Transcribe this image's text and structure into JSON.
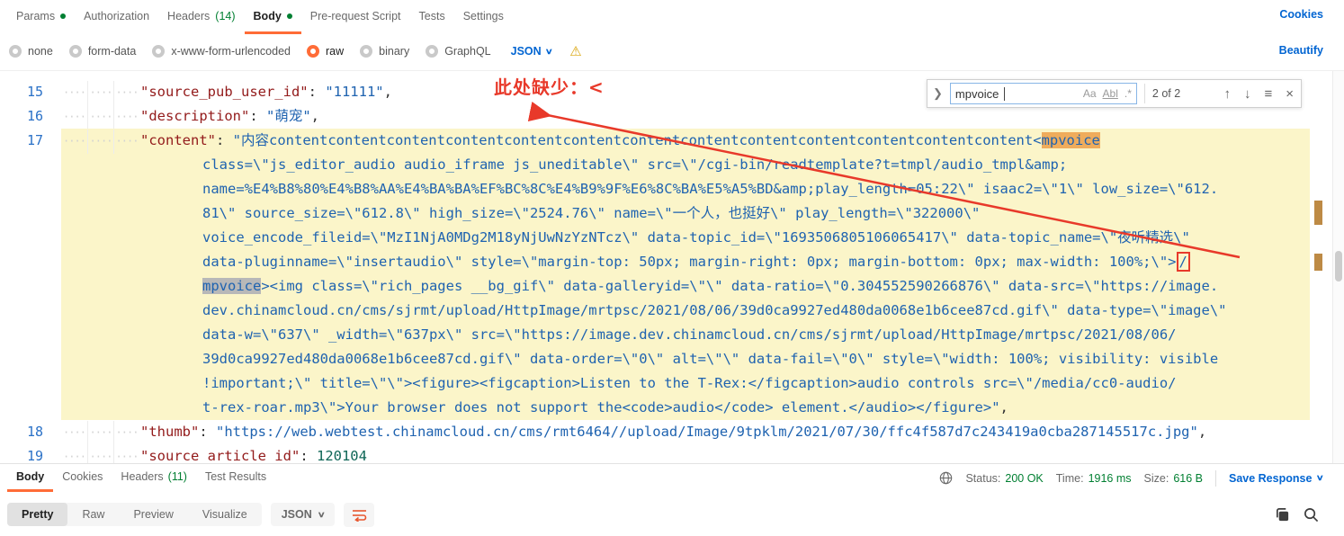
{
  "request_tabs": {
    "items": [
      {
        "label": "Params",
        "dot": true,
        "active": false
      },
      {
        "label": "Authorization",
        "active": false
      },
      {
        "label": "Headers",
        "count": "(14)",
        "active": false
      },
      {
        "label": "Body",
        "dot": true,
        "active": true
      },
      {
        "label": "Pre-request Script",
        "active": false
      },
      {
        "label": "Tests",
        "active": false
      },
      {
        "label": "Settings",
        "active": false
      }
    ],
    "cookies_link": "Cookies"
  },
  "body_type_bar": {
    "options": [
      {
        "label": "none",
        "selected": false
      },
      {
        "label": "form-data",
        "selected": false
      },
      {
        "label": "x-www-form-urlencoded",
        "selected": false
      },
      {
        "label": "raw",
        "selected": true
      },
      {
        "label": "binary",
        "selected": false
      },
      {
        "label": "GraphQL",
        "selected": false
      }
    ],
    "language": "JSON",
    "warning_icon": "warning-triangle",
    "beautify_link": "Beautify"
  },
  "search_panel": {
    "query": "mpvoice",
    "match_case": "Aa",
    "whole_word": "Abl",
    "regex": ".*",
    "result_count": "2 of 2",
    "buttons": [
      "previous-match",
      "next-match",
      "menu",
      "close"
    ]
  },
  "annotation": {
    "text": "此处缺少：<",
    "color": "#e8392a"
  },
  "editor": {
    "lines": [
      {
        "number": "15",
        "highlighted": false,
        "rows": [
          {
            "segments": [
              {
                "t": "\"source_pub_user_id\"",
                "c": "key"
              },
              {
                "t": ": ",
                "c": "p"
              },
              {
                "t": "\"11111\"",
                "c": "str"
              },
              {
                "t": ",",
                "c": "p"
              }
            ]
          }
        ]
      },
      {
        "number": "16",
        "highlighted": false,
        "rows": [
          {
            "segments": [
              {
                "t": "\"description\"",
                "c": "key"
              },
              {
                "t": ": ",
                "c": "p"
              },
              {
                "t": "\"萌宠\"",
                "c": "str"
              },
              {
                "t": ",",
                "c": "p"
              }
            ]
          }
        ]
      },
      {
        "number": "17",
        "highlighted": true,
        "rows": [
          {
            "segments": [
              {
                "t": "\"content\"",
                "c": "key"
              },
              {
                "t": ": ",
                "c": "p"
              },
              {
                "t": "\"内容contentcontentcontentcontentcontentcontentcontentcontentcontentcontentcontentcontentcontent<",
                "c": "str"
              },
              {
                "t": "mpvoice",
                "c": "mc"
              }
            ]
          },
          {
            "segments": [
              {
                "t": "class=\\\"js_editor_audio audio_iframe js_uneditable\\\" src=\\\"/cgi-bin/readtemplate?t=tmpl/audio_tmpl&amp;",
                "c": "str"
              }
            ]
          },
          {
            "segments": [
              {
                "t": "name=%E4%B8%80%E4%B8%AA%E4%BA%BA%EF%BC%8C%E4%B9%9F%E6%8C%BA%E5%A5%BD&amp;play_length=05:22\\\" isaac2=\\\"1\\\" low_size=\\\"612.",
                "c": "str"
              }
            ]
          },
          {
            "segments": [
              {
                "t": "81\\\" source_size=\\\"612.8\\\" high_size=\\\"2524.76\\\" name=\\\"一个人，也挺好\\\" play_length=\\\"322000\\\"",
                "c": "str"
              }
            ]
          },
          {
            "segments": [
              {
                "t": "voice_encode_fileid=\\\"MzI1NjA0MDg2M18yNjUwNzYzNTcz\\\" data-topic_id=\\\"1693506805106065417\\\" data-topic_name=\\\"夜听精选\\\"",
                "c": "str"
              }
            ]
          },
          {
            "segments": [
              {
                "t": "data-pluginname=\\\"insertaudio\\\" style=\\\"margin-top: 50px; margin-right: 0px; margin-bottom: 0px; max-width: 100%;\\\">",
                "c": "str"
              },
              {
                "t": "/",
                "c": "rb"
              }
            ]
          },
          {
            "segments": [
              {
                "t": "mpvoice",
                "c": "mo"
              },
              {
                "t": "><img class=\\\"rich_pages __bg_gif\\\" data-galleryid=\\\"\\\" data-ratio=\\\"0.304552590266876\\\" data-src=\\\"https://image.",
                "c": "str"
              }
            ]
          },
          {
            "segments": [
              {
                "t": "dev.chinamcloud.cn/cms/sjrmt/upload/HttpImage/mrtpsc/2021/08/06/39d0ca9927ed480da0068e1b6cee87cd.gif\\\" data-type=\\\"image\\\"",
                "c": "str"
              }
            ]
          },
          {
            "segments": [
              {
                "t": "data-w=\\\"637\\\" _width=\\\"637px\\\" src=\\\"https://image.dev.chinamcloud.cn/cms/sjrmt/upload/HttpImage/mrtpsc/2021/08/06/",
                "c": "str"
              }
            ]
          },
          {
            "segments": [
              {
                "t": "39d0ca9927ed480da0068e1b6cee87cd.gif\\\" data-order=\\\"0\\\" alt=\\\"\\\" data-fail=\\\"0\\\" style=\\\"width: 100%; visibility: visible",
                "c": "str"
              }
            ]
          },
          {
            "segments": [
              {
                "t": "!important;\\\" title=\\\"\\\"><figure><figcaption>Listen to the T-Rex:</figcaption>audio controls src=\\\"/media/cc0-audio/",
                "c": "str"
              }
            ]
          },
          {
            "segments": [
              {
                "t": "t-rex-roar.mp3\\\">Your browser does not support the<code>audio</code> element.</audio></figure>\"",
                "c": "str"
              },
              {
                "t": ",",
                "c": "p"
              }
            ]
          }
        ]
      },
      {
        "number": "18",
        "highlighted": false,
        "rows": [
          {
            "segments": [
              {
                "t": "\"thumb\"",
                "c": "key"
              },
              {
                "t": ": ",
                "c": "p"
              },
              {
                "t": "\"https://web.webtest.chinamcloud.cn/cms/rmt6464//upload/Image/9tpklm/2021/07/30/ffc4f587d7c243419a0cba287145517c.jpg\"",
                "c": "str"
              },
              {
                "t": ",",
                "c": "p"
              }
            ]
          }
        ]
      },
      {
        "number": "19",
        "highlighted": false,
        "rows": [
          {
            "segments": [
              {
                "t": "\"source_article_id\"",
                "c": "key"
              },
              {
                "t": ": ",
                "c": "p"
              },
              {
                "t": "120104",
                "c": "num"
              }
            ]
          }
        ]
      }
    ]
  },
  "response": {
    "tabs": [
      {
        "label": "Body",
        "active": true
      },
      {
        "label": "Cookies",
        "active": false
      },
      {
        "label": "Headers",
        "count": "(11)",
        "active": false
      },
      {
        "label": "Test Results",
        "active": false
      }
    ],
    "status_label": "Status:",
    "status_value": "200 OK",
    "time_label": "Time:",
    "time_value": "1916 ms",
    "size_label": "Size:",
    "size_value": "616 B",
    "save_response": "Save Response",
    "view_tabs": [
      {
        "label": "Pretty",
        "active": true
      },
      {
        "label": "Raw",
        "active": false
      },
      {
        "label": "Preview",
        "active": false
      },
      {
        "label": "Visualize",
        "active": false
      }
    ],
    "format": "JSON"
  },
  "colors": {
    "accent_orange": "#ff6c37",
    "link_blue": "#0265d2",
    "success_green": "#007f31",
    "key_maroon": "#931b1b",
    "string_blue": "#1f63b0",
    "highlight_yellow": "#fbf5c9",
    "match_current_bg": "#efac5c",
    "match_other_bg": "#b8b8b8",
    "annotation_red": "#e8392a"
  }
}
